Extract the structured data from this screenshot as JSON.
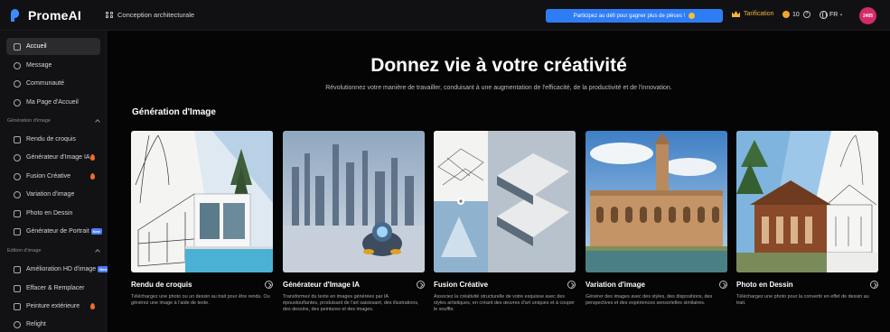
{
  "topbar": {
    "logo_text": "PromeAI",
    "app_name": "Conception architecturale",
    "promo_text": "Participez au défi pour gagner plus de pièces !",
    "pricing_label": "Tarification",
    "coins": "10",
    "help_glyph": "?",
    "language": "FR",
    "language_caret": "⌄",
    "avatar_text": "2405",
    "colors": {
      "accent": "#2f7df6",
      "gold": "#f1b53b",
      "avatar": "#d42a6a"
    }
  },
  "sidebar": {
    "items_top": [
      {
        "label": "Accueil",
        "icon": "home-icon",
        "active": true
      },
      {
        "label": "Message",
        "icon": "bell-icon"
      },
      {
        "label": "Communauté",
        "icon": "community-icon"
      },
      {
        "label": "Ma Page d'Accueil",
        "icon": "user-icon"
      }
    ],
    "section_generation": "Génération d'image",
    "items_generation": [
      {
        "label": "Rendu de croquis",
        "icon": "sketch-render-icon",
        "hot": false
      },
      {
        "label": "Générateur d'Image IA",
        "icon": "image-generator-icon",
        "hot": true
      },
      {
        "label": "Fusion Créative",
        "icon": "fusion-icon",
        "hot": true
      },
      {
        "label": "Variation d'image",
        "icon": "variation-icon",
        "hot": false
      },
      {
        "label": "Photo en Dessin",
        "icon": "photo-to-drawing-icon",
        "hot": false
      },
      {
        "label": "Générateur de Portrait",
        "icon": "portrait-icon",
        "badge": "New"
      }
    ],
    "section_edition": "Edition d'image",
    "items_edition": [
      {
        "label": "Amélioration HD d'image",
        "icon": "hd-icon",
        "badge": "New"
      },
      {
        "label": "Effacer & Remplacer",
        "icon": "erase-icon"
      },
      {
        "label": "Peinture extérieure",
        "icon": "outpaint-icon",
        "hot": true
      },
      {
        "label": "Relight",
        "icon": "relight-icon"
      }
    ]
  },
  "hero": {
    "title": "Donnez vie à votre créativité",
    "subtitle": "Révolutionnez votre manière de travailler, conduisant à une augmentation de l'efficacité, de la productivité et de l'innovation."
  },
  "section": {
    "title": "Génération d'Image"
  },
  "cards": [
    {
      "title": "Rendu de croquis",
      "desc": "Téléchargez une photo ou un dessin au trait pour être rendu. Ou générez une image à l'aide de texte."
    },
    {
      "title": "Générateur d'Image IA",
      "desc": "Transformez du texte en images générées par IA époustouflantes, produisant de l'art saisissant, des illustrations, des dessins, des peintures et des images."
    },
    {
      "title": "Fusion Créative",
      "desc": "Associez la créativité structurelle de votre esquisse avec des styles artistiques, en créant des œuvres d'art uniques et à couper le souffle."
    },
    {
      "title": "Variation d'image",
      "desc": "Générer des images avec des styles, des dispositions, des perspectives et des expériences sensorielles similaires."
    },
    {
      "title": "Photo en Dessin",
      "desc": "Téléchargez une photo pour la convertir en effet de dessin au trait."
    }
  ]
}
